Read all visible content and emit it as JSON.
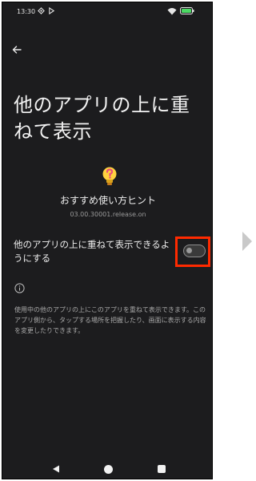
{
  "status_bar": {
    "time": "13:30"
  },
  "page": {
    "title": "他のアプリの上に重ねて表示"
  },
  "app": {
    "name": "おすすめ使い方ヒント",
    "package": "03.00.30001.release.on"
  },
  "setting": {
    "label": "他のアプリの上に重ねて表示できるようにする",
    "enabled": false
  },
  "description": "使用中の他のアプリの上にこのアプリを重ねて表示できます。このアプリ側から、タップする場所を把握したり、画面に表示する内容を変更したりできます。",
  "colors": {
    "background": "#1c1c1e",
    "highlight": "#ff2a00"
  },
  "icons": {
    "back": "arrow-left-icon",
    "app": "lightbulb-question-icon",
    "info": "info-circle-icon"
  }
}
